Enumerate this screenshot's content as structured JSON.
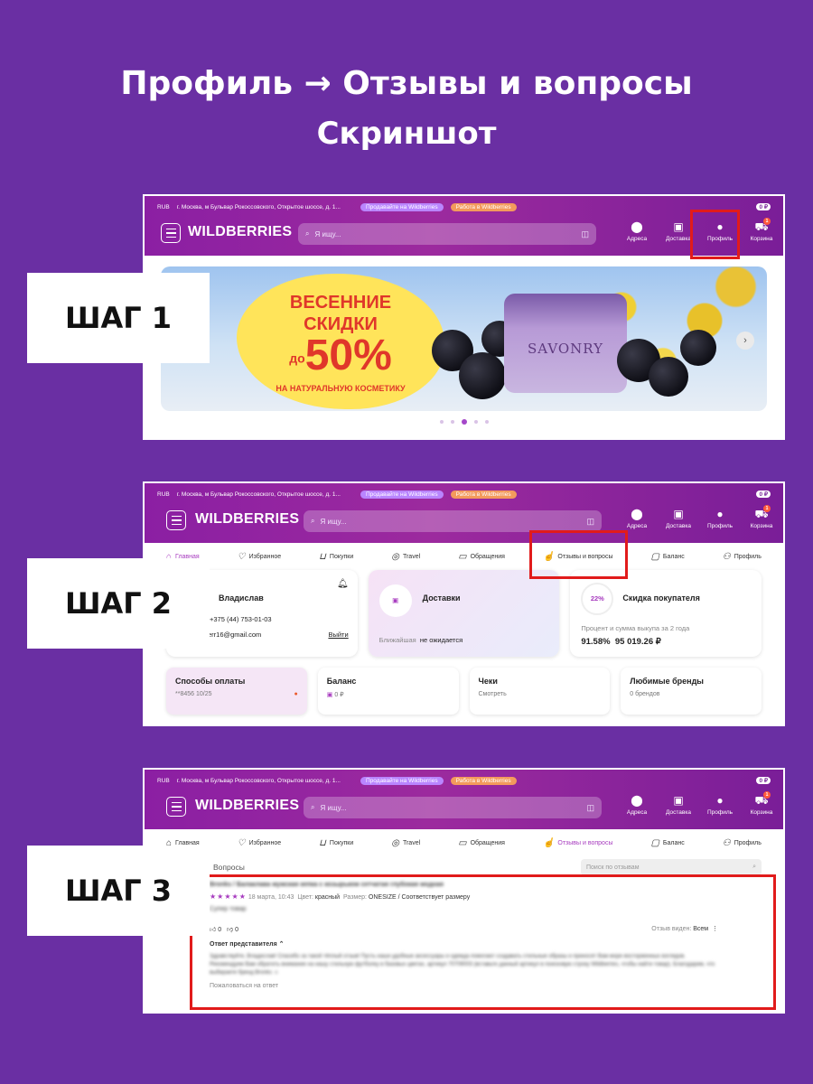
{
  "title": {
    "line1": "Профиль → Отзывы и вопросы",
    "line2": "Скриншот"
  },
  "steps": [
    "ШАГ 1",
    "ШАГ 2",
    "ШАГ 3"
  ],
  "header": {
    "currency": "RUB",
    "address": "г. Москва, м Бульвар Рокоссовского, Открытое шоссе, д. 1...",
    "sell_pill": "Продавайте на Wildberries",
    "work_pill": "Работа в Wildberries",
    "balance": "0 ₽",
    "logo": "WILDBERRIES",
    "search_placeholder": "Я ищу...",
    "nav": {
      "address": "Адреса",
      "delivery": "Доставка",
      "profile": "Профиль",
      "cart": "Корзина"
    },
    "cart_count": "1"
  },
  "banner": {
    "line1": "ВЕСЕННИЕ",
    "line2": "СКИДКИ",
    "prefix": "до",
    "percent": "50%",
    "sub": "НА НАТУРАЛЬНУЮ КОСМЕТИКУ",
    "brand": "SAVONRY",
    "arrow": "›",
    "slide_index": 3,
    "slide_total": 5
  },
  "profile_tabs": [
    "Главная",
    "Избранное",
    "Покупки",
    "Travel",
    "Обращения",
    "Отзывы и вопросы",
    "Баланс",
    "Профиль"
  ],
  "user_card": {
    "name": "Владислав",
    "phone": "+375 (44) 753-01-03",
    "email": "err16@gmail.com",
    "logout": "Выйти"
  },
  "delivery_card": {
    "title": "Доставки",
    "label": "Ближайшая",
    "value": "не ожидается"
  },
  "discount_card": {
    "percent": "22%",
    "title": "Скидка покупателя",
    "sub": "Процент и сумма выкупа за 2 года",
    "v1": "91.58%",
    "v2": "95 019.26 ₽"
  },
  "small_cards": [
    {
      "title": "Способы оплаты",
      "sub": "**8456  10/25"
    },
    {
      "title": "Баланс",
      "sub": "0 ₽"
    },
    {
      "title": "Чеки",
      "sub": "Смотреть"
    },
    {
      "title": "Любимые бренды",
      "sub": "0 брендов"
    }
  ],
  "reviews": {
    "tab_label": "Вопросы",
    "filter_placeholder": "Поиск по отзывам",
    "product": "Bronks / Балаклава мужская кепка с козырьком сетчатая глубокая модная",
    "stars": "★★★★★",
    "date": "18 марта, 10:43",
    "color_label": "Цвет:",
    "color_value": "красный",
    "size_label": "Размер:",
    "size_value": "ONESIZE / Соответствует размеру",
    "text": "Супер товар",
    "likes": "0",
    "dislikes": "0",
    "visible_label": "Отзыв виден:",
    "visible_value": "Всем",
    "answer_title": "Ответ представителя",
    "answer_text": "Здравствуйте, Владислав! Спасибо за такой тёплый отзыв! Пусть наши удобные аксессуары и одежда помогают создавать стильные образы и приносят Вам море восторженных взглядов. Рекомендуем Вам обратить внимание на нашу стильную футболку в базовых цветах, артикул 70709003 (вставьте данный артикул в поисковую строку Wildberries, чтобы найти товар). Благодарим, что выбираете бренд Bronks ☺",
    "complain": "Пожаловаться на ответ"
  },
  "colors": {
    "bg": "#6a2fa3",
    "accent": "#a73bbf",
    "highlight": "#e11b1b"
  }
}
